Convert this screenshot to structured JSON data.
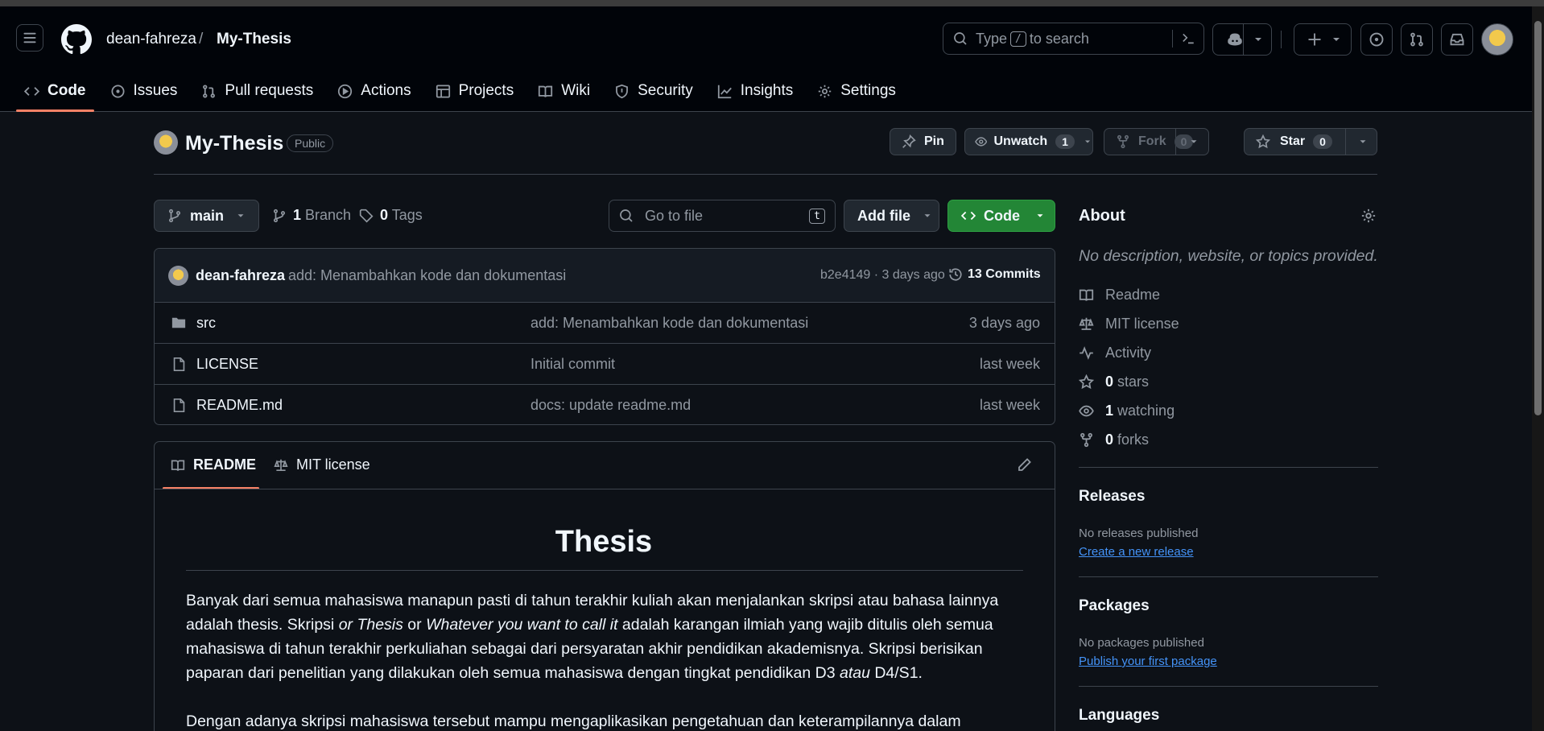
{
  "header": {
    "owner": "dean-fahreza",
    "separator": "/",
    "repo": "My-Thesis",
    "search_prefix": "Type",
    "search_key": "/",
    "search_suffix": "to search"
  },
  "tabs": [
    {
      "label": "Code"
    },
    {
      "label": "Issues"
    },
    {
      "label": "Pull requests"
    },
    {
      "label": "Actions"
    },
    {
      "label": "Projects"
    },
    {
      "label": "Wiki"
    },
    {
      "label": "Security"
    },
    {
      "label": "Insights"
    },
    {
      "label": "Settings"
    }
  ],
  "repo_head": {
    "name": "My-Thesis",
    "visibility": "Public",
    "pin_label": "Pin",
    "unwatch_label": "Unwatch",
    "unwatch_count": "1",
    "fork_label": "Fork",
    "fork_count": "0",
    "star_label": "Star",
    "star_count": "0"
  },
  "toolbar": {
    "branch": "main",
    "branch_count": "1",
    "branch_label": "Branch",
    "tag_count": "0",
    "tag_label": "Tags",
    "goto_placeholder": "Go to file",
    "goto_key": "t",
    "add_file": "Add file",
    "code": "Code"
  },
  "commit": {
    "author": "dean-fahreza",
    "message": "add: Menambahkan kode dan dokumentasi",
    "hash_time": "b2e4149 · 3 days ago",
    "commits": "13 Commits"
  },
  "files": [
    {
      "name": "src",
      "type": "folder",
      "message": "add: Menambahkan kode dan dokumentasi",
      "time": "3 days ago"
    },
    {
      "name": "LICENSE",
      "type": "file",
      "message": "Initial commit",
      "time": "last week"
    },
    {
      "name": "README.md",
      "type": "file",
      "message": "docs: update readme.md",
      "time": "last week"
    }
  ],
  "readme": {
    "tab_readme": "README",
    "tab_license": "MIT license",
    "title": "Thesis",
    "p1_a": "Banyak dari semua mahasiswa manapun pasti di tahun terakhir kuliah akan menjalankan skripsi atau bahasa lainnya adalah thesis. Skripsi ",
    "p1_b": "or Thesis",
    "p1_c": " or ",
    "p1_d": "Whatever you want to call it",
    "p1_e": " adalah karangan ilmiah yang wajib ditulis oleh semua mahasiswa di tahun terakhir perkuliahan sebagai dari persyaratan akhir pendidikan akademisnya. Skripsi berisikan paparan dari penelitian yang dilakukan oleh semua mahasiswa dengan tingkat pendidikan D3 ",
    "p1_f": "atau",
    "p1_g": " D4/S1.",
    "p2": "Dengan adanya skripsi mahasiswa tersebut mampu mengaplikasikan pengetahuan dan keterampilannya dalam"
  },
  "about": {
    "title": "About",
    "description": "No description, website, or topics provided.",
    "readme": "Readme",
    "license": "MIT license",
    "activity": "Activity",
    "stars_count": "0",
    "stars_label": "stars",
    "watching_count": "1",
    "watching_label": "watching",
    "forks_count": "0",
    "forks_label": "forks"
  },
  "releases": {
    "title": "Releases",
    "none": "No releases published",
    "link": "Create a new release"
  },
  "packages": {
    "title": "Packages",
    "none": "No packages published",
    "link": "Publish your first package"
  },
  "languages": {
    "title": "Languages"
  },
  "colors": {
    "accent_tab": "#f78166",
    "code_button": "#238636",
    "link": "#4493f8"
  }
}
